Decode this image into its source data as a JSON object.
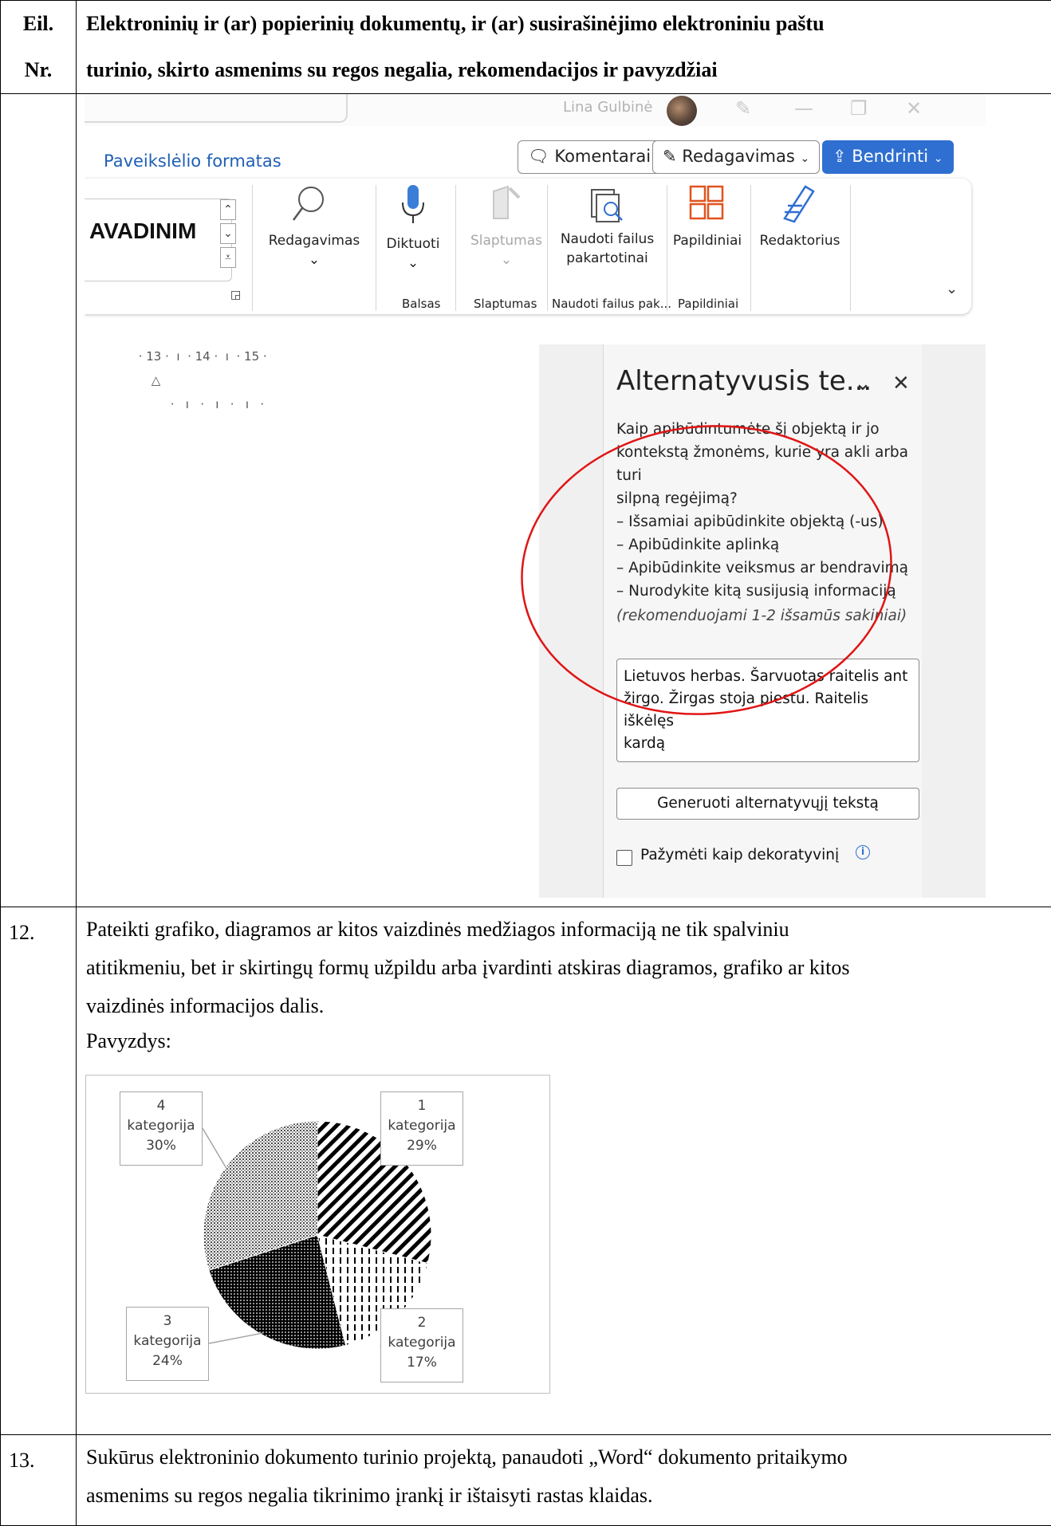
{
  "header": {
    "col_number_line1": "Eil.",
    "col_number_line2": "Nr.",
    "col_title_line1": "Elektroninių ir (ar) popierinių dokumentų, ir (ar) susirašinėjimo elektroniniu paštu",
    "col_title_line2": "turinio, skirto asmenims su regos negalia, rekomendacijos ir pavyzdžiai"
  },
  "screenshot": {
    "user_name": "Lina Gulbinė",
    "tab_name": "Paveikslėlio formatas",
    "buttons": {
      "comments": "Komentarai",
      "editing": "Redagavimas",
      "share": "Bendrinti"
    },
    "style_box": {
      "style_name": "AVADINIM"
    },
    "ribbon": {
      "editing_label": "Redagavimas",
      "dictate_label": "Diktuoti",
      "sensitivity_label": "Slaptumas",
      "reuse_label_line1": "Naudoti failus",
      "reuse_label_line2": "pakartotinai",
      "addins_label": "Papildiniai",
      "editor_label": "Redaktorius",
      "group_voice": "Balsas",
      "group_sensitivity": "Slaptumas",
      "group_reuse": "Naudoti failus pak...",
      "group_addins": "Papildiniai"
    },
    "ruler_text": "· 13 ·  ı  · 14 ·  ı  · 15 ·",
    "ruler_text_right": "·   ı   ·   ı   ·   ı   ·",
    "alt_pane": {
      "title": "Alternatyvusis te...",
      "prompt_lines": [
        "Kaip apibūdintumėte šį objektą ir jo",
        "kontekstą žmonėms, kurie yra akli arba turi",
        "silpną regėjimą?",
        "– Išsamiai apibūdinkite objektą (-us)",
        "– Apibūdinkite aplinką",
        "– Apibūdinkite veiksmus ar bendravimą",
        "– Nurodykite kitą susijusią informaciją"
      ],
      "hint": "(rekomenduojami 1-2 išsamūs sakiniai)",
      "alt_text_lines": [
        "Lietuvos herbas. Šarvuotas raitelis ant",
        "žirgo. Žirgas stoja piestu. Raitelis iškėlęs",
        "kardą"
      ],
      "generate_button": "Generuoti alternatyvųjį tekstą",
      "decorative_label": "Pažymėti kaip dekoratyvinį",
      "decorative_checked": false
    }
  },
  "row12": {
    "number": "12.",
    "text_lines": [
      "Pateikti grafiko, diagramos ar kitos vaizdinės medžiagos informaciją ne tik spalviniu",
      "atitikmeniu, bet ir skirtingų formų užpildu arba įvardinti atskiras diagramos, grafiko ar kitos",
      "vaizdinės informacijos dalis."
    ],
    "example_label": "Pavyzdys:"
  },
  "row13": {
    "number": "13.",
    "text_lines": [
      "Sukūrus elektroninio dokumento turinio projektą, panaudoti „Word“ dokumento pritaikymo",
      "asmenims su regos negalia tikrinimo įrankį ir ištaisyti rastas klaidas."
    ]
  },
  "chart_data": {
    "type": "pie",
    "title": "",
    "slices": [
      {
        "label_line1": "1",
        "label_line2": "kategorija",
        "percent_label": "29%",
        "value": 29,
        "pattern": "diagonal-stripes"
      },
      {
        "label_line1": "2",
        "label_line2": "kategorija",
        "percent_label": "17%",
        "value": 17,
        "pattern": "vertical-dashes"
      },
      {
        "label_line1": "3",
        "label_line2": "kategorija",
        "percent_label": "24%",
        "value": 24,
        "pattern": "dense-dots"
      },
      {
        "label_line1": "4",
        "label_line2": "kategorija",
        "percent_label": "30%",
        "value": 30,
        "pattern": "light-dots"
      }
    ],
    "colors": {
      "ink": "#000000",
      "callout_border": "#a6a6a6",
      "callout_text": "#404040"
    }
  }
}
